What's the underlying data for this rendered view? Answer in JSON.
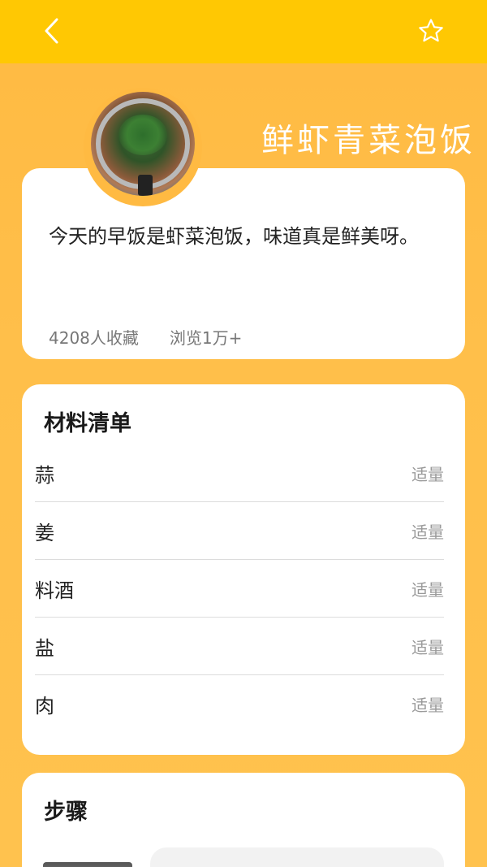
{
  "header": {
    "back_icon": "chevron-left-icon",
    "favorite_icon": "star-outline-icon"
  },
  "recipe": {
    "title": "鲜虾青菜泡饭",
    "description": "今天的早饭是虾菜泡饭，味道真是鲜美呀。",
    "favorites": "4208人收藏",
    "views": "浏览1万+"
  },
  "ingredients": {
    "title": "材料清单",
    "items": [
      {
        "name": "蒜",
        "qty": "适量"
      },
      {
        "name": "姜",
        "qty": "适量"
      },
      {
        "name": "料酒",
        "qty": "适量"
      },
      {
        "name": "盐",
        "qty": "适量"
      },
      {
        "name": "肉",
        "qty": "适量"
      }
    ]
  },
  "steps": {
    "title": "步骤"
  },
  "colors": {
    "topbar": "#ffc803",
    "background": "#ffba42",
    "highlight": "#84ff33"
  }
}
